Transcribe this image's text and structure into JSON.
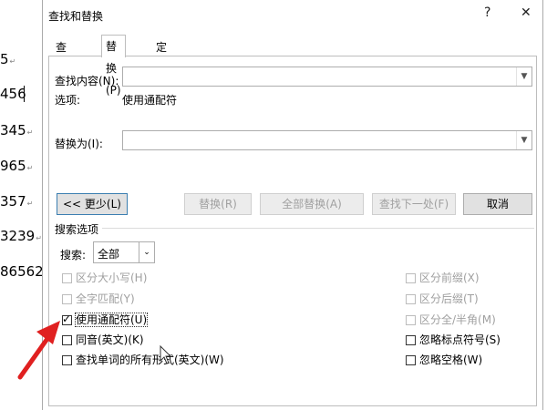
{
  "document": {
    "lines": [
      "5",
      "456",
      "345",
      "965",
      "357",
      "3239",
      "86562"
    ],
    "para_mark": "↵"
  },
  "dialog": {
    "title": "查找和替换",
    "help_label": "?",
    "close_label": "✕",
    "tabs": [
      {
        "label": "查找(D)",
        "active": false
      },
      {
        "label": "替换(P)",
        "active": true
      },
      {
        "label": "定位(G)",
        "active": false
      }
    ],
    "find_label": "查找内容(N):",
    "find_value": "",
    "options_label": "选项:",
    "options_value": "使用通配符",
    "replace_label": "替换为(I):",
    "replace_value": "",
    "buttons": {
      "less": "<< 更少(L)",
      "replace": "替换(R)",
      "replace_all": "全部替换(A)",
      "find_next": "查找下一处(F)",
      "cancel": "取消"
    },
    "search_options_header": "搜索选项",
    "search_label": "搜索:",
    "search_value": "全部",
    "checkboxes_left": [
      {
        "label": "区分大小写(H)",
        "checked": false,
        "enabled": false
      },
      {
        "label": "全字匹配(Y)",
        "checked": false,
        "enabled": false
      },
      {
        "label": "使用通配符(U)",
        "checked": true,
        "enabled": true
      },
      {
        "label": "同音(英文)(K)",
        "checked": false,
        "enabled": true
      },
      {
        "label": "查找单词的所有形式(英文)(W)",
        "checked": false,
        "enabled": true
      }
    ],
    "checkboxes_right": [
      {
        "label": "区分前缀(X)",
        "checked": false,
        "enabled": false
      },
      {
        "label": "区分后缀(T)",
        "checked": false,
        "enabled": false
      },
      {
        "label": "区分全/半角(M)",
        "checked": false,
        "enabled": false
      },
      {
        "label": "忽略标点符号(S)",
        "checked": false,
        "enabled": true
      },
      {
        "label": "忽略空格(W)",
        "checked": false,
        "enabled": true
      }
    ]
  },
  "annotation": {
    "arrow_color": "#e02020"
  }
}
